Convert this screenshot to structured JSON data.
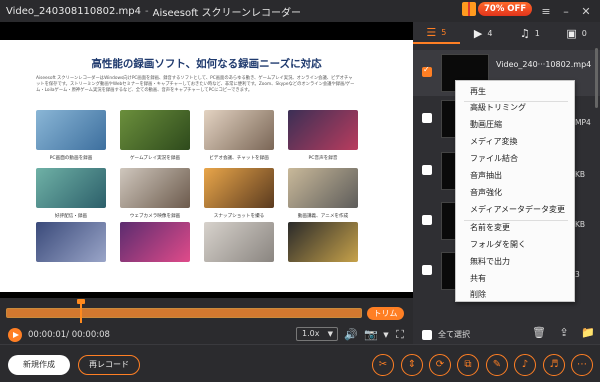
{
  "window": {
    "title": "Video_240308110802.mp4",
    "separator": "-",
    "app_name": "Aiseesoft スクリーンレコーダー",
    "promo_badge": "70% OFF"
  },
  "preview": {
    "heading": "高性能の録画ソフト、如何なる録画ニーズに対応",
    "description": "Aiseesoft スクリーンレコーダーはWindows向けPC画面を録画、録音するソフトとして、PC画面のあらゆる動き、ゲームプレイ実況、オンライン会議、ビデオチャットを保存です。ストリーミング動画やWebセミナーを録画・キャプチャーしておきたい時など、非常に便利です。Zoom、Skypeなどのオンライン会議や録画/ゲーム・Loilaゲーム・原神ゲーム実況を録画するなど、全ての動画、音声をキャプチャーしてPCにコピーできます。",
    "cards": [
      {
        "caption": "PC画面の動画を録画"
      },
      {
        "caption": "ゲームプレイ実況を録画"
      },
      {
        "caption": "ビデオ会議、チャットを録画"
      },
      {
        "caption": "PC音声を録音"
      },
      {
        "caption": "好評配信・録画"
      },
      {
        "caption": "ウェブカメラ映像を録画"
      },
      {
        "caption": "スナップショットを撮る"
      },
      {
        "caption": "動画講義、アニメを作成"
      }
    ]
  },
  "timeline": {
    "trim_label": "トリム",
    "time_display": "00:00:01/ 00:00:08",
    "speed": "1.0x",
    "progress": 0.21
  },
  "panel": {
    "tabs": [
      {
        "icon": "list-icon",
        "count": "5"
      },
      {
        "icon": "video-icon",
        "count": "4"
      },
      {
        "icon": "music-icon",
        "count": "1"
      },
      {
        "icon": "image-icon",
        "count": "0"
      }
    ],
    "files": [
      {
        "name": "Video_240···10802.mp4",
        "meta": "",
        "checked": true
      },
      {
        "name": "",
        "meta": "MP4",
        "checked": false
      },
      {
        "name": "",
        "meta": "KB",
        "checked": false
      },
      {
        "name": "",
        "meta": "KB",
        "checked": false
      },
      {
        "name": "",
        "meta": "3",
        "checked": false
      }
    ],
    "select_all_label": "全て選択"
  },
  "context_menu": {
    "items": [
      "再生",
      "高級トリミング",
      "動画圧縮",
      "メディア変換",
      "ファイル結合",
      "音声抽出",
      "音声強化",
      "メディアメータデータ変更",
      "名前を変更",
      "フォルダを開く",
      "無料で出力",
      "共有",
      "削除"
    ]
  },
  "bottom": {
    "new_label": "新規作成",
    "rerecord_label": "再レコード"
  },
  "colors": {
    "accent": "#ff7f24",
    "panel_bg": "#2f2f33",
    "app_bg": "#2b2b2e"
  }
}
